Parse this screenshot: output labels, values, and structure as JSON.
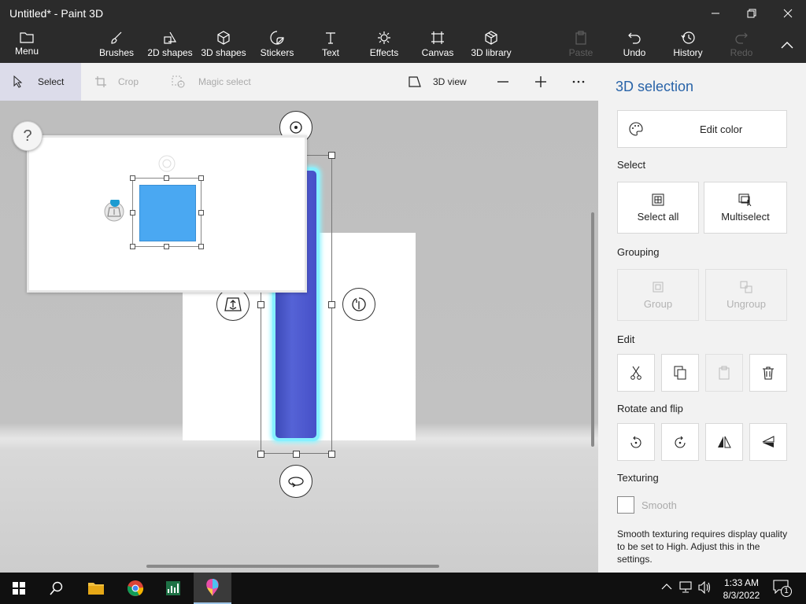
{
  "window": {
    "title": "Untitled* - Paint 3D"
  },
  "ribbon": {
    "menu": "Menu",
    "brushes": "Brushes",
    "shapes2d": "2D shapes",
    "shapes3d": "3D shapes",
    "stickers": "Stickers",
    "text": "Text",
    "effects": "Effects",
    "canvas": "Canvas",
    "library3d": "3D library",
    "paste": "Paste",
    "undo": "Undo",
    "history": "History",
    "redo": "Redo"
  },
  "toolbar": {
    "select": "Select",
    "crop": "Crop",
    "magic_select": "Magic select",
    "view3d": "3D view"
  },
  "canvas": {
    "help": "?"
  },
  "panel": {
    "title": "3D selection",
    "edit_color": "Edit color",
    "select_heading": "Select",
    "select_all": "Select all",
    "multiselect": "Multiselect",
    "grouping_heading": "Grouping",
    "group": "Group",
    "ungroup": "Ungroup",
    "edit_heading": "Edit",
    "rotate_heading": "Rotate and flip",
    "texturing_heading": "Texturing",
    "smooth": "Smooth",
    "smooth_checked": false,
    "note": "Smooth texturing requires display quality to be set to High. Adjust this in the settings."
  },
  "taskbar": {
    "time": "1:33 AM",
    "date": "8/3/2022",
    "notifications": "1"
  },
  "colors": {
    "accent": "#2863a8",
    "cylinder": "#4f5bd0",
    "cylinder_glow": "#8ff4ff",
    "square": "#4aa8f2"
  }
}
